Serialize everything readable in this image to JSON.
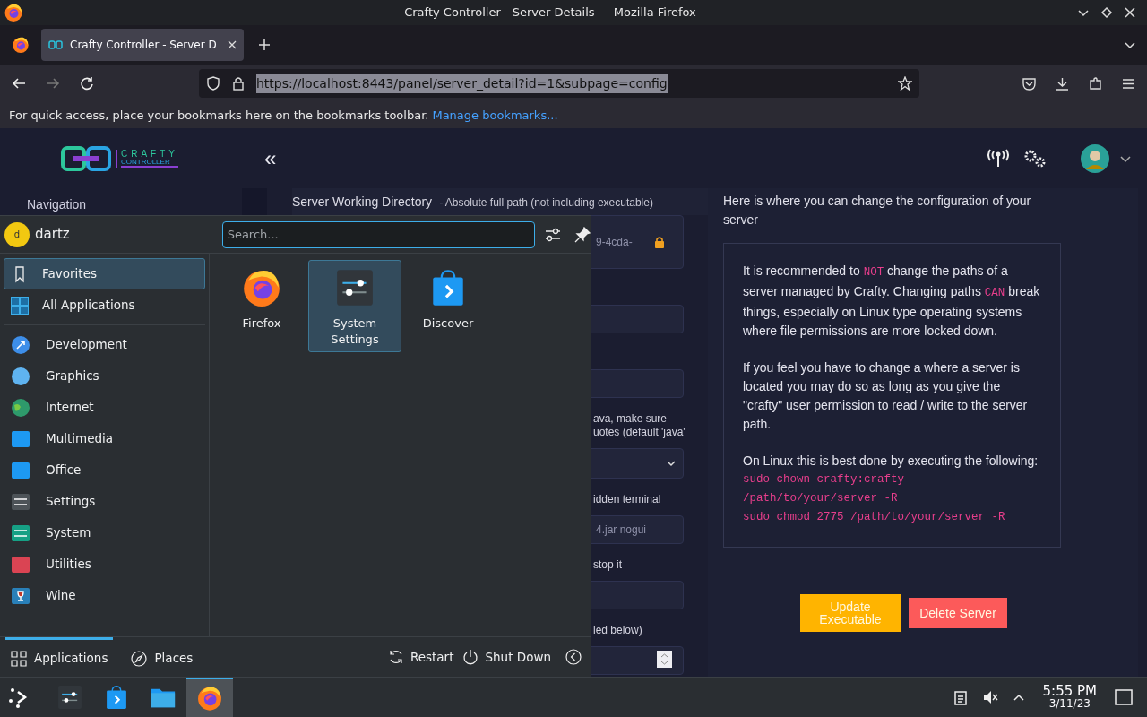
{
  "window": {
    "title": "Crafty Controller - Server Details — Mozilla Firefox"
  },
  "browser": {
    "tabs": [
      {
        "label": "Crafty Controller - Server D",
        "selected": true
      }
    ],
    "url": "https://localhost:8443/panel/server_detail?id=1&subpage=config",
    "bookmarks_hint": "For quick access, place your bookmarks here on the bookmarks toolbar.",
    "bookmarks_link": "Manage bookmarks..."
  },
  "page": {
    "logo": {
      "line1": "CRAFTY",
      "line2": "CONTROLLER"
    },
    "collapse": "«",
    "sidebar_heading": "Navigation",
    "middle": {
      "label": "Server Working Directory",
      "hint": "- Absolute full path (not including executable)",
      "items": [
        {
          "kind": "field",
          "value": "9-4cda-",
          "locked": true
        },
        {
          "kind": "field"
        },
        {
          "kind": "field"
        },
        {
          "kind": "text",
          "lines": [
            "ava, make sure",
            "uotes (default 'java'"
          ]
        },
        {
          "kind": "select"
        },
        {
          "kind": "text",
          "lines": [
            "idden terminal"
          ]
        },
        {
          "kind": "field",
          "value": "4.jar nogui"
        },
        {
          "kind": "text",
          "lines": [
            "stop it"
          ]
        },
        {
          "kind": "field"
        },
        {
          "kind": "text",
          "lines": [
            "led below)"
          ]
        },
        {
          "kind": "number"
        }
      ]
    },
    "right": {
      "intro": "Here is where you can change the configuration of your server",
      "notice": [
        [
          {
            "kind": "plain",
            "text": "It is recommended to "
          },
          {
            "kind": "code",
            "text": "NOT"
          },
          {
            "kind": "plain",
            "text": " change the paths of a server managed by Crafty. Changing paths "
          },
          {
            "kind": "code",
            "text": "CAN"
          },
          {
            "kind": "plain",
            "text": " break things, especially on Linux type operating systems where file permissions are more locked down."
          }
        ],
        [
          {
            "kind": "plain",
            "text": "If you feel you have to change a where a server is located you may do so as long as you give the \"crafty\" user permission to read / write to the server path."
          }
        ],
        [
          {
            "kind": "plain",
            "text": "On Linux this is best done by executing the following:"
          },
          {
            "kind": "command",
            "text": "sudo chown crafty:crafty /path/to/your/server -R"
          },
          {
            "kind": "command",
            "text": "sudo chmod 2775 /path/to/your/server -R"
          }
        ]
      ],
      "buttons": [
        {
          "label": "Update Executable",
          "kind": "warning"
        },
        {
          "label": "Delete Server",
          "kind": "danger"
        }
      ]
    }
  },
  "launcher": {
    "user": "dartz",
    "avatar_letter": "d",
    "search_placeholder": "Search...",
    "views": [
      {
        "label": "Favorites",
        "selected": true
      },
      {
        "label": "All Applications",
        "selected": false
      }
    ],
    "categories": [
      {
        "label": "Development",
        "selected": false
      },
      {
        "label": "Graphics",
        "selected": false
      },
      {
        "label": "Internet",
        "selected": false
      },
      {
        "label": "Multimedia",
        "selected": false
      },
      {
        "label": "Office",
        "selected": false
      },
      {
        "label": "Settings",
        "selected": false
      },
      {
        "label": "System",
        "selected": false
      },
      {
        "label": "Utilities",
        "selected": false
      },
      {
        "label": "Wine",
        "selected": false
      }
    ],
    "favorites": [
      {
        "label": "Firefox",
        "kind": "firefox",
        "selected": false
      },
      {
        "label": "System Settings",
        "kind": "settings",
        "selected": true
      },
      {
        "label": "Discover",
        "kind": "discover",
        "selected": false
      }
    ],
    "footer_tabs": [
      {
        "label": "Applications",
        "selected": true
      },
      {
        "label": "Places",
        "selected": false
      }
    ],
    "actions": [
      {
        "label": "Restart",
        "kind": "restart"
      },
      {
        "label": "Shut Down",
        "kind": "shutdown"
      }
    ]
  },
  "taskbar": {
    "tasks": [
      {
        "kind": "settings",
        "active": false
      },
      {
        "kind": "discover",
        "active": false
      },
      {
        "kind": "folder",
        "active": false
      },
      {
        "kind": "firefox",
        "active": true
      }
    ],
    "time": "5:55 PM",
    "date": "3/11/23"
  }
}
